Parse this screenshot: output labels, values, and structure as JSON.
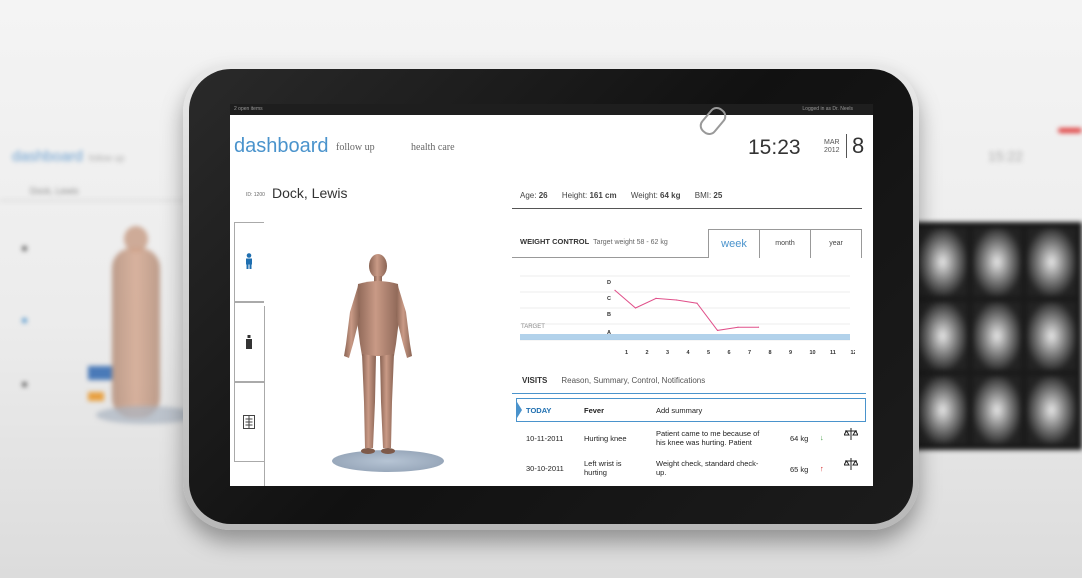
{
  "status_bar": {
    "left": "2 open items",
    "right": "Logged in as Dr. Neels"
  },
  "header": {
    "logo": "dashboard",
    "nav": [
      "follow up",
      "health care"
    ],
    "time": "15:23",
    "month": "MAR",
    "year": "2012",
    "day": "8"
  },
  "patient": {
    "id": "ID: 1200",
    "name": "Dock, Lewis",
    "age_label": "Age:",
    "age": "26",
    "height_label": "Height:",
    "height": "161 cm",
    "weight_label": "Weight:",
    "weight": "64 kg",
    "bmi_label": "BMI:",
    "bmi": "25"
  },
  "side_tabs": [
    {
      "icon": "person-icon",
      "glyph": "🚹"
    },
    {
      "icon": "bottle-icon",
      "glyph": "▲"
    },
    {
      "icon": "spine-icon",
      "glyph": "☰"
    }
  ],
  "weight_control": {
    "title": "WEIGHT CONTROL",
    "target": "Target weight 58 - 62 kg",
    "tabs": [
      "week",
      "month",
      "year"
    ],
    "selected_tab": "week",
    "target_label": "TARGET"
  },
  "chart_data": {
    "type": "line",
    "x": [
      1,
      2,
      3,
      4,
      5,
      6,
      7
    ],
    "categories_x": [
      "1",
      "2",
      "3",
      "4",
      "5",
      "6",
      "7",
      "8",
      "9",
      "10",
      "11",
      "12"
    ],
    "y_levels": [
      "A",
      "B",
      "C",
      "D"
    ],
    "values": [
      3.1,
      2.0,
      2.6,
      2.5,
      2.3,
      0.6,
      0.8,
      0.8
    ],
    "points_x": [
      0,
      1,
      2,
      3,
      4,
      5,
      6,
      7
    ],
    "target_band": [
      0.0,
      0.5
    ],
    "line_color": "#e0508a",
    "target_color": "#9fc7e6"
  },
  "visits": {
    "title": "VISITS",
    "subtitle": "Reason, Summary, Control, Notifications",
    "today": {
      "date": "TODAY",
      "reason": "Fever",
      "summary": "Add summary"
    },
    "rows": [
      {
        "date": "10-11-2011",
        "reason": "Hurting knee",
        "summary1": "Patient came to me because of",
        "summary2": "his knee was hurting. Patient",
        "weight": "64 kg",
        "trend": "↓",
        "trend_color": "#3a9a3a"
      },
      {
        "date": "30-10-2011",
        "reason1": "Left wrist is",
        "reason2": "hurting",
        "summary1": "Weight check, standard check-",
        "summary2": "up.",
        "weight": "65 kg",
        "trend": "↑",
        "trend_color": "#d02020"
      }
    ]
  },
  "background": {
    "logo": "dashboard",
    "nav": "follow up",
    "name": "Dock, Lewis",
    "time": "15:22"
  }
}
